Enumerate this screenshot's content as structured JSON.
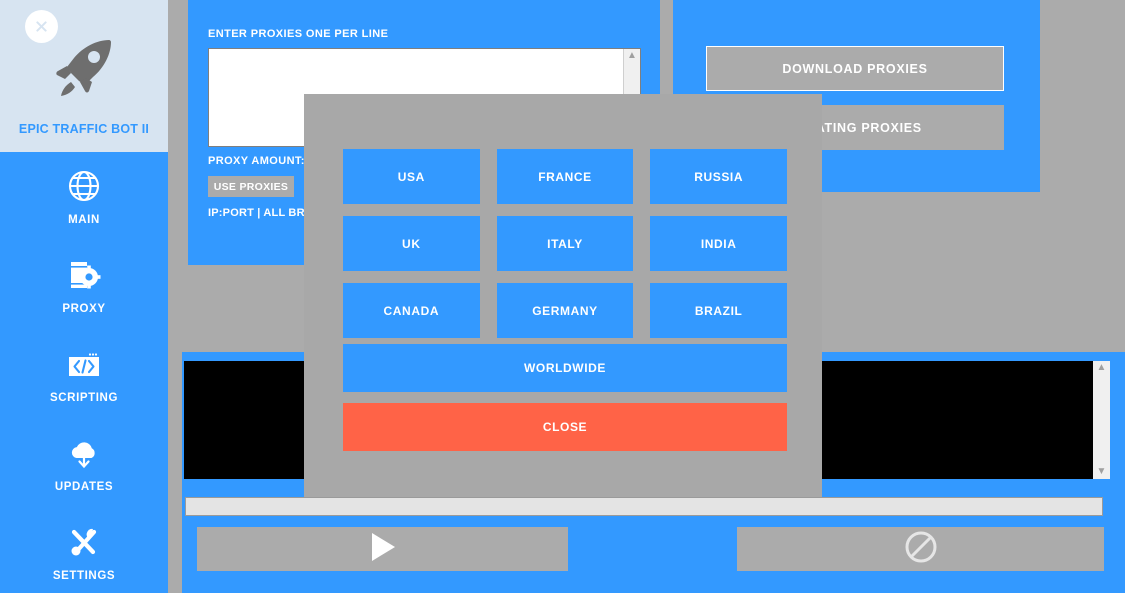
{
  "colors": {
    "brand_blue": "#3399ff",
    "sidebar_header": "#d7e4f1",
    "gray_surface": "#ababab",
    "modal_gray": "#a8a8a8",
    "close_red": "#ff6347",
    "log_black": "#000000",
    "progress_track": "#e4e4e4"
  },
  "sidebar": {
    "close_icon": "close-icon",
    "logo_icon": "rocket-icon",
    "app_title": "EPIC TRAFFIC BOT II",
    "items": [
      {
        "label": "MAIN",
        "icon": "globe-icon"
      },
      {
        "label": "PROXY",
        "icon": "proxy-gear-icon"
      },
      {
        "label": "SCRIPTING",
        "icon": "code-window-icon"
      },
      {
        "label": "UPDATES",
        "icon": "cloud-download-icon"
      },
      {
        "label": "SETTINGS",
        "icon": "tools-icon"
      }
    ]
  },
  "proxy_panel": {
    "enter_proxies_label": "ENTER PROXIES ONE PER LINE",
    "textarea_value": "",
    "textarea_placeholder": "",
    "scroll_up_icon": "chevron-up-icon",
    "scroll_down_icon": "chevron-down-icon",
    "proxy_amount_label": "PROXY AMOUNT:",
    "use_proxies_label": "USE PROXIES",
    "format_lines": "IP:PORT | ALL BRO\nIP:PORT@USERNA\nIP:PORT@USERNA"
  },
  "download_panel": {
    "download_proxies_label": "DOWNLOAD PROXIES",
    "rotating_proxies_label": "ROTATING PROXIES"
  },
  "modal": {
    "countries": [
      "USA",
      "FRANCE",
      "RUSSIA",
      "UK",
      "ITALY",
      "INDIA",
      "CANADA",
      "GERMANY",
      "BRAZIL"
    ],
    "worldwide_label": "WORLDWIDE",
    "close_label": "CLOSE"
  },
  "bottom": {
    "log_left_text": "",
    "log_right_text": "",
    "scroll_up_icon": "chevron-up-icon",
    "scroll_down_icon": "chevron-down-icon",
    "progress_percent": 0,
    "start_icon": "play-icon",
    "stop_icon": "prohibited-icon"
  }
}
